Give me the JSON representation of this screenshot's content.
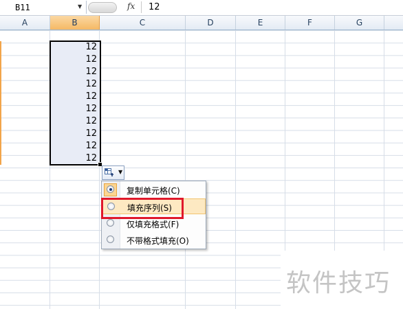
{
  "formula_bar": {
    "name_box": "B11",
    "fx_label": "fx",
    "value": "12"
  },
  "columns": [
    "A",
    "B",
    "C",
    "D",
    "E",
    "F",
    "G"
  ],
  "selected_column": "B",
  "cells": {
    "B": [
      "12",
      "12",
      "12",
      "12",
      "12",
      "12",
      "12",
      "12",
      "12",
      "12"
    ]
  },
  "autofill_menu": {
    "items": [
      {
        "label": "复制单元格(C)",
        "selected": true
      },
      {
        "label": "填充序列(S)",
        "selected": false
      },
      {
        "label": "仅填充格式(F)",
        "selected": false
      },
      {
        "label": "不带格式填充(O)",
        "selected": false
      }
    ]
  },
  "colors": {
    "selection_fill": "#e8ecf6",
    "highlight_border": "#e0182b",
    "column_header_selected": "#f5b965"
  },
  "watermark": "软件技巧"
}
